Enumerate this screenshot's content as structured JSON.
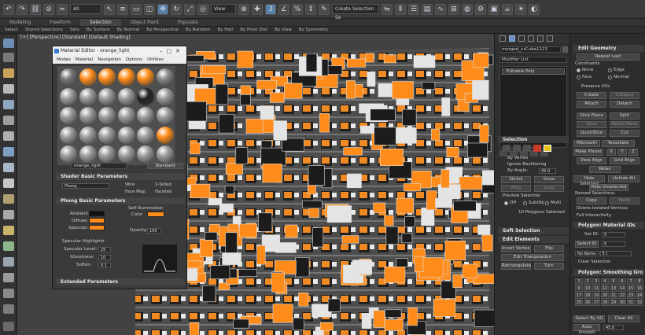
{
  "toolbar": {
    "filter_dropdown": "All",
    "view_dropdown": "View",
    "selection_set": "Create Selection Se"
  },
  "ribbon": {
    "tabs": [
      "Modeling",
      "Freeform",
      "Selection",
      "Object Paint",
      "Populate"
    ],
    "active_tab": "Selection",
    "sub_items": [
      "Select",
      "Stored Selections",
      "Sets",
      "By Surface",
      "By Normal",
      "By Perspective",
      "By Random",
      "By Half",
      "By Pivot Dist",
      "By View",
      "By Symmetry"
    ]
  },
  "viewport": {
    "label": "[+] [Perspective] [Standard] [Default Shading]"
  },
  "material_editor": {
    "title": "Material Editor - orange_light",
    "menu": [
      "Modes",
      "Material",
      "Navigation",
      "Options",
      "Utilities"
    ],
    "material_name": "orange_light",
    "material_type": "Standard",
    "shader_basic_title": "Shader Basic Parameters",
    "shader_type": "Phong",
    "wire_label": "Wire",
    "two_sided_label": "2-Sided",
    "face_map_label": "Face Map",
    "faceted_label": "Faceted",
    "phong_basic_title": "Phong Basic Parameters",
    "self_illum_label": "Self-Illumination",
    "color_label": "Color",
    "ambient_label": "Ambient:",
    "diffuse_label": "Diffuse:",
    "specular_label": "Specular:",
    "opacity_label": "Opacity:",
    "opacity_value": "100",
    "spec_highlights_title": "Specular Highlights",
    "spec_level_label": "Specular Level:",
    "spec_level_value": "25",
    "glossiness_label": "Glossiness:",
    "glossiness_value": "10",
    "soften_label": "Soften:",
    "soften_value": "0.1",
    "extended_title": "Extended Parameters"
  },
  "command_panel": {
    "object_name": "merged_urCube1123",
    "modifier_list": "Modifier List",
    "stack_item": "Editable Poly",
    "selection_title": "Selection",
    "by_vertex": "By Vertex",
    "ignore_backfacing": "Ignore Backfacing",
    "by_angle": "By Angle:",
    "by_angle_value": "45.0",
    "shrink": "Shrink",
    "grow": "Grow",
    "ring": "Ring",
    "loop": "Loop",
    "preview_selection": "Preview Selection",
    "off": "Off",
    "subobj": "SubObj",
    "multi": "Multi",
    "selected_count": "10 Polygons Selected",
    "soft_selection_title": "Soft Selection",
    "edit_elements_title": "Edit Elements",
    "insert_vertex": "Insert Vertex",
    "flip": "Flip",
    "edit_triangulation": "Edit Triangulation",
    "retriangulate": "Retriangulate",
    "turn": "Turn"
  },
  "edit_geometry": {
    "title": "Edit Geometry",
    "repeat_last": "Repeat Last",
    "constraints": "Constraints",
    "none": "None",
    "edge": "Edge",
    "face": "Face",
    "normal": "Normal",
    "preserve_uvs": "Preserve UVs",
    "create": "Create",
    "collapse": "Collapse",
    "attach": "Attach",
    "detach": "Detach",
    "slice_plane": "Slice Plane",
    "split": "Split",
    "slice": "Slice",
    "reset_plane": "Reset Plane",
    "quickslice": "QuickSlice",
    "cut": "Cut",
    "msmooth": "MSmooth",
    "tessellate": "Tessellate",
    "make_planar": "Make Planar",
    "x": "X",
    "y": "Y",
    "z": "Z",
    "view_align": "View Align",
    "grid_align": "Grid Align",
    "relax": "Relax",
    "hide_selected": "Hide Selected",
    "unhide_all": "Unhide All",
    "hide_unselected": "Hide Unselected",
    "named_selections": "Named Selections:",
    "copy": "Copy",
    "paste": "Paste",
    "delete_isolated": "Delete Isolated Vertices",
    "full_interactivity": "Full Interactivity",
    "material_ids_title": "Polygon: Material IDs",
    "set_id": "Set ID:",
    "set_id_value": "5",
    "select_id": "Select ID",
    "select_id_value": "5",
    "no_name": "No Name - ( 5 )",
    "clear_selection": "Clear Selection",
    "smoothing_title": "Polygon: Smoothing Gro",
    "smoothing_ids": [
      "1",
      "2",
      "3",
      "4",
      "5",
      "6",
      "7",
      "8",
      "9",
      "10",
      "11",
      "12",
      "13",
      "14",
      "15",
      "16",
      "17",
      "18",
      "19",
      "20",
      "21",
      "22",
      "23",
      "24",
      "25",
      "26",
      "27",
      "28",
      "29",
      "30",
      "31",
      "32"
    ],
    "select_by_sg": "Select By SG",
    "clear_all": "Clear All",
    "auto_smooth": "Auto Smooth",
    "auto_smooth_value": "45.0"
  },
  "colors": {
    "accent_orange": "#ff8c1a",
    "ui_dark": "#2b2b2b",
    "active_blue": "#5a7fa8"
  }
}
